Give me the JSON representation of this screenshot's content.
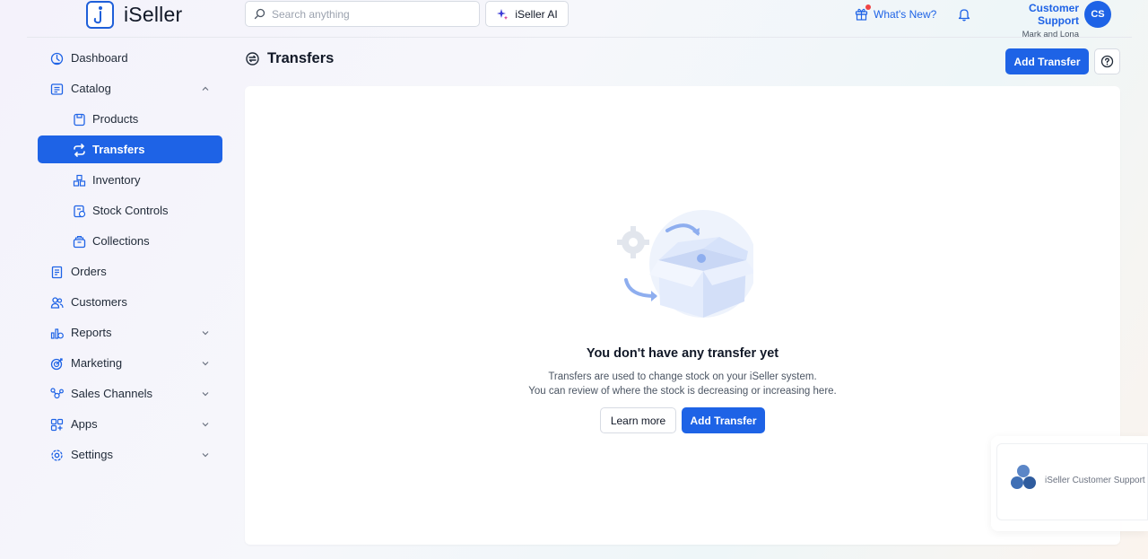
{
  "header": {
    "logo_text": "iSeller",
    "search_placeholder": "Search anything",
    "ai_label": "iSeller AI",
    "whats_new": "What's New?",
    "user_name": "Customer Support",
    "user_store": "Mark and Lona",
    "avatar_initials": "CS"
  },
  "sidebar": {
    "items": [
      {
        "label": "Dashboard",
        "icon": "dashboard-icon"
      },
      {
        "label": "Catalog",
        "icon": "catalog-icon",
        "expanded": true
      },
      {
        "label": "Products",
        "icon": "products-icon"
      },
      {
        "label": "Transfers",
        "icon": "transfers-icon",
        "active": true
      },
      {
        "label": "Inventory",
        "icon": "inventory-icon"
      },
      {
        "label": "Stock Controls",
        "icon": "stock-controls-icon"
      },
      {
        "label": "Collections",
        "icon": "collections-icon"
      },
      {
        "label": "Orders",
        "icon": "orders-icon"
      },
      {
        "label": "Customers",
        "icon": "customers-icon"
      },
      {
        "label": "Reports",
        "icon": "reports-icon"
      },
      {
        "label": "Marketing",
        "icon": "marketing-icon"
      },
      {
        "label": "Sales Channels",
        "icon": "sales-channels-icon"
      },
      {
        "label": "Apps",
        "icon": "apps-icon"
      },
      {
        "label": "Settings",
        "icon": "settings-icon"
      }
    ]
  },
  "main": {
    "title": "Transfers",
    "add_button": "Add Transfer",
    "empty_title": "You don't have any transfer yet",
    "empty_line1": "Transfers are used to change stock on your iSeller system.",
    "empty_line2": "You can review of where the stock is decreasing or increasing here.",
    "learn_more": "Learn more",
    "add_transfer": "Add Transfer"
  },
  "support_widget": {
    "label": "iSeller Customer Support"
  },
  "colors": {
    "accent": "#1e63e6",
    "text": "#1f2937"
  }
}
